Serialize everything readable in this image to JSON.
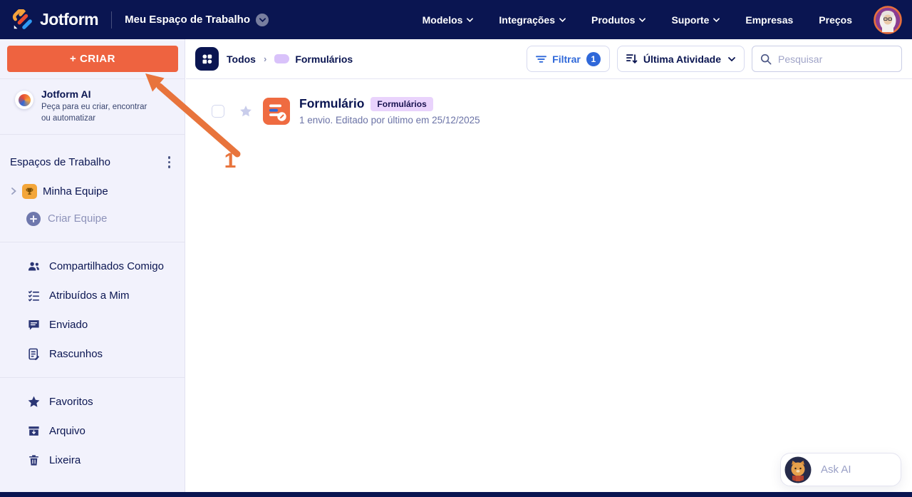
{
  "brand": {
    "name": "Jotform"
  },
  "topnav": {
    "workspace": "Meu Espaço de Trabalho",
    "items": [
      {
        "label": "Modelos"
      },
      {
        "label": "Integrações"
      },
      {
        "label": "Produtos"
      },
      {
        "label": "Suporte"
      },
      {
        "label": "Empresas"
      },
      {
        "label": "Preços"
      }
    ]
  },
  "sidebar": {
    "create_button": "+ CRIAR",
    "ai_title": "Jotform AI",
    "ai_subtitle": "Peça para eu criar, encontrar ou automatizar",
    "workspaces_header": "Espaços de Trabalho",
    "team_item": "Minha Equipe",
    "create_team": "Criar Equipe",
    "items": [
      {
        "label": "Compartilhados Comigo",
        "icon": "shared-people-icon"
      },
      {
        "label": "Atribuídos a Mim",
        "icon": "assigned-list-icon"
      },
      {
        "label": "Enviado",
        "icon": "sent-message-icon"
      },
      {
        "label": "Rascunhos",
        "icon": "draft-document-icon"
      }
    ],
    "secondary_items": [
      {
        "label": "Favoritos",
        "icon": "star-icon"
      },
      {
        "label": "Arquivo",
        "icon": "archive-icon"
      },
      {
        "label": "Lixeira",
        "icon": "trash-icon"
      }
    ]
  },
  "toolbar": {
    "breadcrumb": {
      "root": "Todos",
      "current": "Formulários"
    },
    "filter_label": "Filtrar",
    "filter_count": "1",
    "sort_label": "Última Atividade",
    "search_placeholder": "Pesquisar"
  },
  "list": {
    "rows": [
      {
        "title": "Formulário",
        "badge": "Formulários",
        "meta": "1 envio. Editado por último em 25/12/2025"
      }
    ]
  },
  "annotation": {
    "step_number": "1"
  },
  "ask_ai": {
    "label": "Ask AI"
  },
  "colors": {
    "navy": "#0a1551",
    "accent_orange": "#ee6340",
    "arrow_orange": "#e8743c",
    "filter_blue": "#2f68d9",
    "sidebar_bg": "#f2f2fc",
    "badge_bg": "#e9d3fc"
  }
}
